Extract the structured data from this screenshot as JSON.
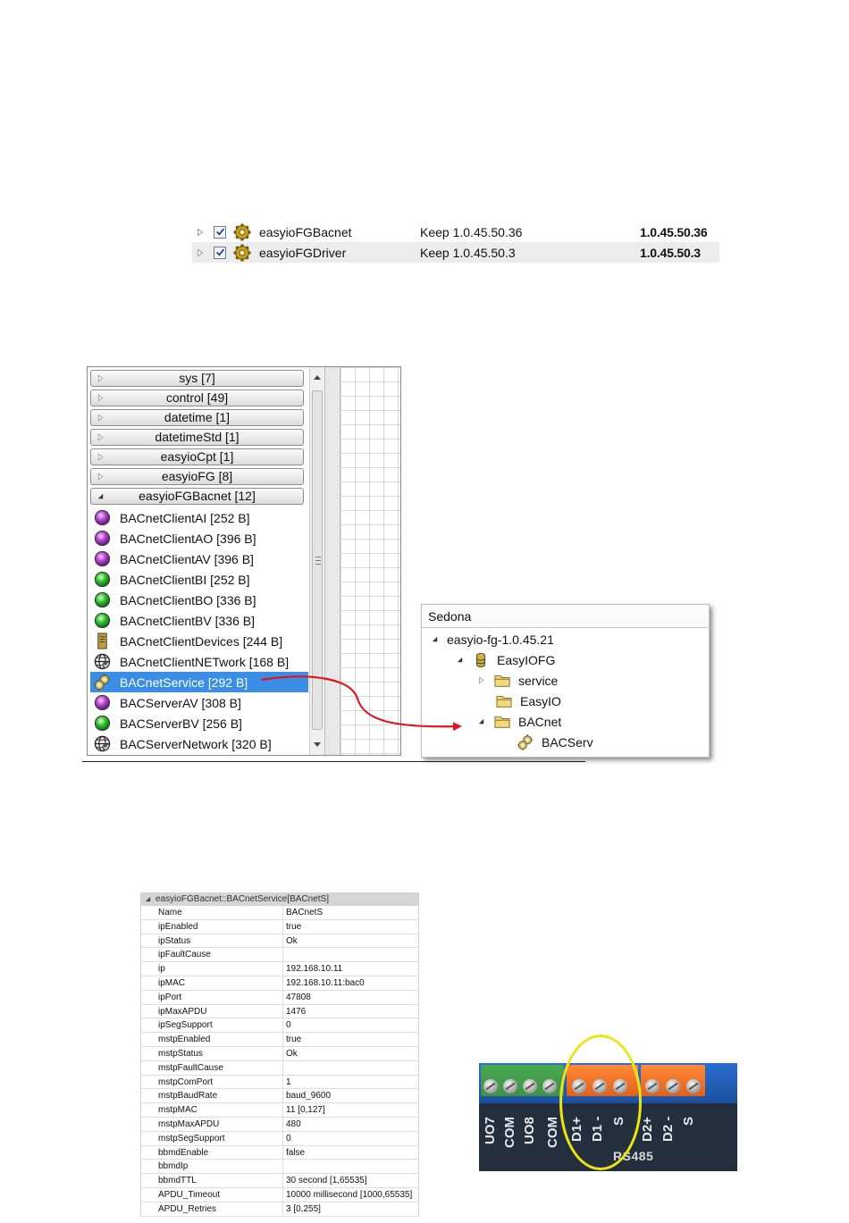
{
  "kits": [
    {
      "name": "easyioFGBacnet",
      "action": "Keep 1.0.45.50.36",
      "version": "1.0.45.50.36",
      "checked": true
    },
    {
      "name": "easyioFGDriver",
      "action": "Keep 1.0.45.50.3",
      "version": "1.0.45.50.3",
      "checked": true
    }
  ],
  "palette": {
    "groups": [
      "sys [7]",
      "control [49]",
      "datetime [1]",
      "datetimeStd [1]",
      "easyioCpt [1]",
      "easyioFG [8]"
    ],
    "expanded_group": "easyioFGBacnet [12]",
    "components": [
      {
        "label": "BACnetClientAI [252 B]",
        "icon": "purple-ball-icon"
      },
      {
        "label": "BACnetClientAO [396 B]",
        "icon": "purple-ball-icon"
      },
      {
        "label": "BACnetClientAV [396 B]",
        "icon": "purple-ball-icon"
      },
      {
        "label": "BACnetClientBI [252 B]",
        "icon": "green-ball-icon"
      },
      {
        "label": "BACnetClientBO [336 B]",
        "icon": "green-ball-icon"
      },
      {
        "label": "BACnetClientBV [336 B]",
        "icon": "green-ball-icon"
      },
      {
        "label": "BACnetClientDevices [244 B]",
        "icon": "device-icon"
      },
      {
        "label": "BACnetClientNETwork [168 B]",
        "icon": "globe-icon"
      },
      {
        "label": "BACnetService [292 B]",
        "icon": "gears-icon",
        "selected": true
      },
      {
        "label": "BACServerAV [308 B]",
        "icon": "purple-ball-icon"
      },
      {
        "label": "BACServerBV [256 B]",
        "icon": "green-ball-icon"
      },
      {
        "label": "BACServerNetwork [320 B]",
        "icon": "globe-icon"
      }
    ]
  },
  "sedona": {
    "title": "Sedona",
    "nodes": [
      {
        "label": "easyio-fg-1.0.45.21",
        "expand": "expanded",
        "icon": ""
      },
      {
        "label": "EasyIOFG",
        "expand": "expanded",
        "icon": "database-icon"
      },
      {
        "label": "service",
        "expand": "collapsed",
        "icon": "folder-icon"
      },
      {
        "label": "EasyIO",
        "expand": "none",
        "icon": "folder-icon"
      },
      {
        "label": "BACnet",
        "expand": "expanded",
        "icon": "folder-icon"
      },
      {
        "label": "BACServ",
        "expand": "none",
        "icon": "gears-icon"
      }
    ]
  },
  "properties": {
    "header": "easyioFGBacnet::BACnetService[BACnetS]",
    "rows": [
      {
        "name": "Name",
        "value": "BACnetS"
      },
      {
        "name": "ipEnabled",
        "value": "true"
      },
      {
        "name": "ipStatus",
        "value": "Ok"
      },
      {
        "name": "ipFaultCause",
        "value": ""
      },
      {
        "name": "ip",
        "value": "192.168.10.11"
      },
      {
        "name": "ipMAC",
        "value": "192.168.10.11:bac0"
      },
      {
        "name": "ipPort",
        "value": "47808"
      },
      {
        "name": "ipMaxAPDU",
        "value": "1476"
      },
      {
        "name": "ipSegSupport",
        "value": "0"
      },
      {
        "name": "mstpEnabled",
        "value": "true"
      },
      {
        "name": "mstpStatus",
        "value": "Ok"
      },
      {
        "name": "mstpFaultCause",
        "value": ""
      },
      {
        "name": "mstpComPort",
        "value": "1"
      },
      {
        "name": "mstpBaudRate",
        "value": "baud_9600"
      },
      {
        "name": "mstpMAC",
        "value": "11 [0,127]"
      },
      {
        "name": "mstpMaxAPDU",
        "value": "480"
      },
      {
        "name": "mstpSegSupport",
        "value": "0"
      },
      {
        "name": "bbmdEnable",
        "value": "false"
      },
      {
        "name": "bbmdIp",
        "value": ""
      },
      {
        "name": "bbmdTTL",
        "value": "30 second [1,65535]"
      },
      {
        "name": "APDU_Timeout",
        "value": "10000 millisecond [1000,65535]"
      },
      {
        "name": "APDU_Retries",
        "value": "3 [0,255]"
      }
    ]
  },
  "terminal": {
    "labels": [
      "UO7",
      "COM",
      "UO8",
      "COM",
      "D1+",
      "D1 -",
      "S",
      "D2+",
      "D2 -",
      "S"
    ],
    "bus_label": "RS485",
    "colors": {
      "board": "#242f3e",
      "block_green": "#3d9445",
      "block_orange": "#f07426",
      "highlight": "#ece416"
    }
  },
  "colors": {
    "selection": "#3b8ee6",
    "arrow": "#e0141b"
  }
}
